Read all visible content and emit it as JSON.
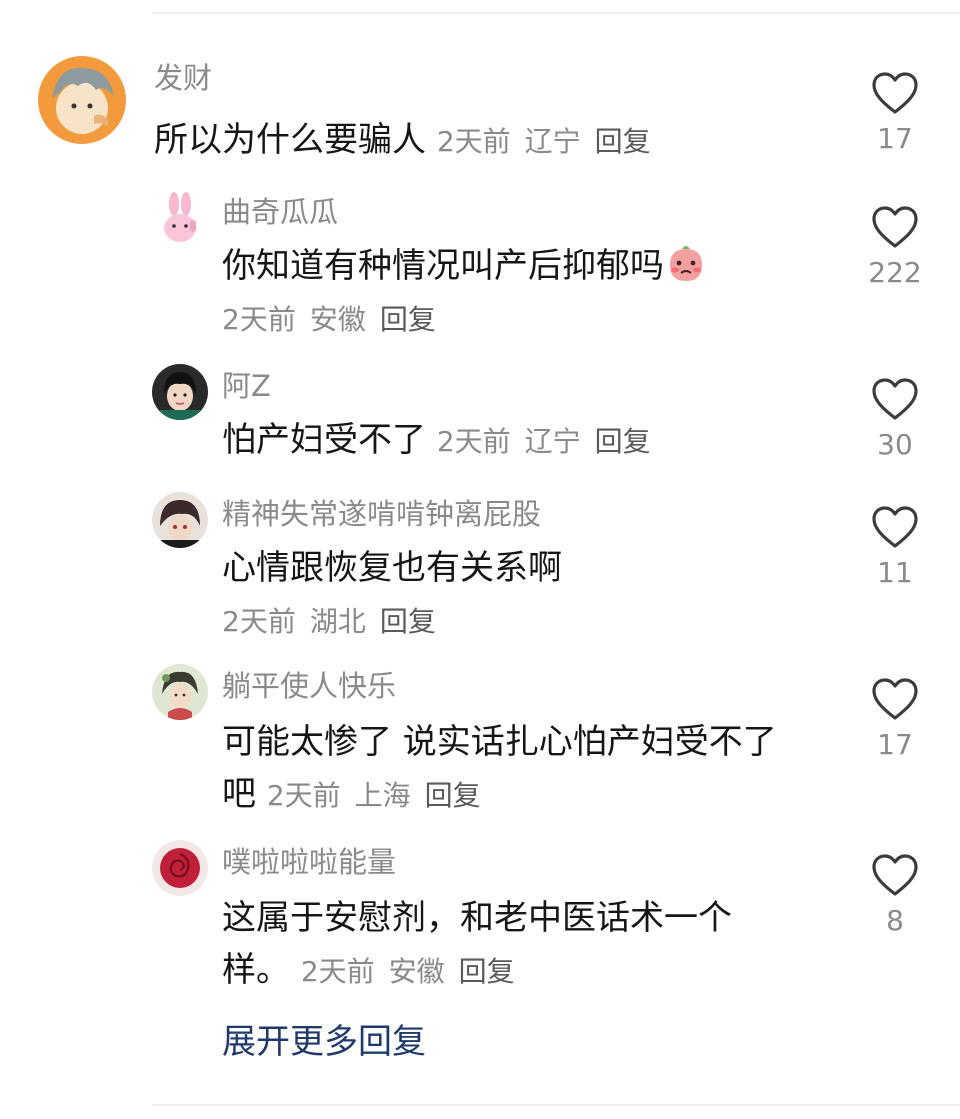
{
  "comments": [
    {
      "username": "发财",
      "text": "所以为什么要骗人",
      "time": "2天前",
      "location": "辽宁",
      "reply_label": "回复",
      "likes": "17",
      "avatar_icon": "anime-character-avatar-icon"
    },
    {
      "username": "曲奇瓜瓜",
      "text": "你知道有种情况叫产后抑郁吗",
      "time": "2天前",
      "location": "安徽",
      "reply_label": "回复",
      "likes": "222",
      "avatar_icon": "pink-rabbit-avatar-icon",
      "emoji": "crying-blush-face-emoji"
    },
    {
      "username": "阿Z",
      "text": "怕产妇受不了",
      "time": "2天前",
      "location": "辽宁",
      "reply_label": "回复",
      "likes": "30",
      "avatar_icon": "girl-portrait-avatar-icon"
    },
    {
      "username": "精神失常遂啃啃钟离屁股",
      "text": "心情跟恢复也有关系啊",
      "time": "2天前",
      "location": "湖北",
      "reply_label": "回复",
      "likes": "11",
      "avatar_icon": "anime-boy-avatar-icon"
    },
    {
      "username": "躺平使人快乐",
      "text": "可能太惨了 说实话扎心怕产妇受不了吧",
      "time": "2天前",
      "location": "上海",
      "reply_label": "回复",
      "likes": "17",
      "avatar_icon": "painting-lady-avatar-icon"
    },
    {
      "username": "噗啦啦啦能量",
      "text": "这属于安慰剂，和老中医话术一个样。",
      "time": "2天前",
      "location": "安徽",
      "reply_label": "回复",
      "likes": "8",
      "avatar_icon": "red-rose-avatar-icon"
    }
  ],
  "expand_label": "展开更多回复",
  "colors": {
    "text": "#161616",
    "meta": "#8a8a8a",
    "link": "#1f3a6b",
    "heart_stroke": "#3c3c3c",
    "divider": "#efefef"
  }
}
